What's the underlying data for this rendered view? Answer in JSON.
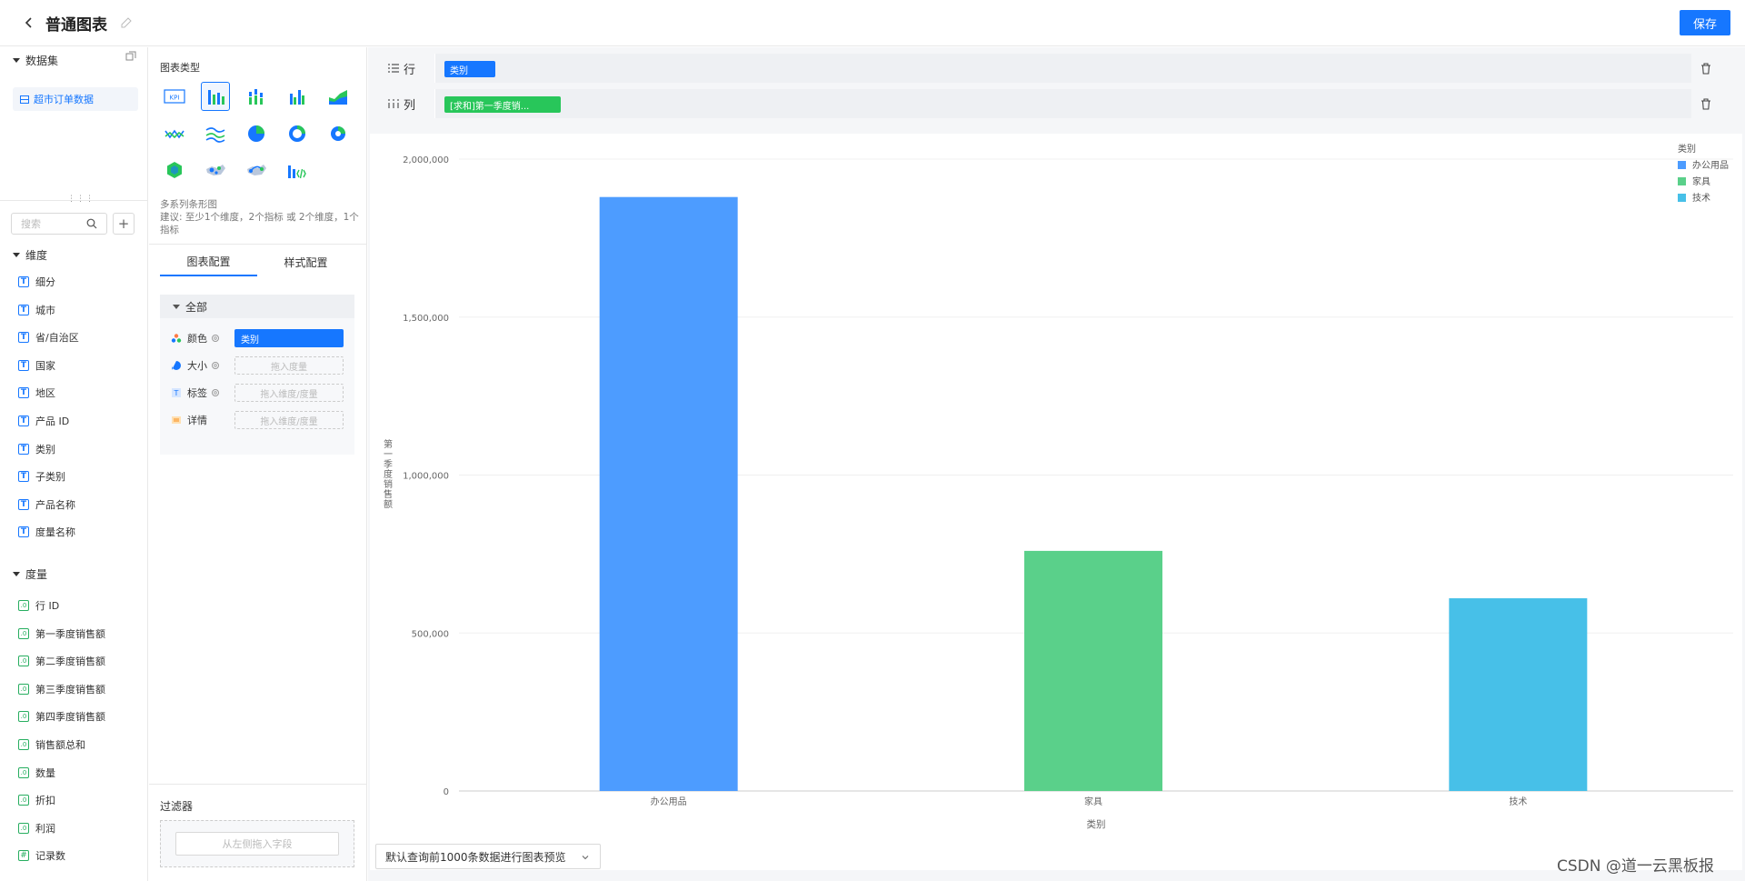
{
  "header": {
    "title": "普通图表",
    "save_label": "保存"
  },
  "left": {
    "dataset_section": "数据集",
    "dataset_name": "超市订单数据",
    "search_placeholder": "搜索",
    "dimension_section": "维度",
    "dimensions": [
      "细分",
      "城市",
      "省/自治区",
      "国家",
      "地区",
      "产品 ID",
      "类别",
      "子类别",
      "产品名称",
      "度量名称"
    ],
    "measure_section": "度量",
    "measures": [
      "行 ID",
      "第一季度销售额",
      "第二季度销售额",
      "第三季度销售额",
      "第四季度销售额",
      "销售额总和",
      "数量",
      "折扣",
      "利润",
      "记录数"
    ]
  },
  "middle": {
    "chart_type_label": "图表类型",
    "chart_types": [
      "kpi",
      "multi-bar",
      "stacked-bar",
      "grouped-bar",
      "area",
      "line",
      "multi-line",
      "pie",
      "donut",
      "ring",
      "hex-map",
      "scatter-map",
      "flow-map",
      "custom-bar"
    ],
    "hint_title": "多系列条形图",
    "hint_text": "建议: 至少1个维度，2个指标 或 2个维度，1个指标",
    "tab_chart": "图表配置",
    "tab_style": "样式配置",
    "group_all": "全部",
    "color_label": "颜色",
    "color_value": "类别",
    "size_label": "大小",
    "size_placeholder": "拖入度量",
    "label_label": "标签",
    "label_placeholder": "拖入维度/度量",
    "detail_label": "详情",
    "detail_placeholder": "拖入维度/度量",
    "filter_label": "过滤器",
    "filter_placeholder": "从左侧拖入字段"
  },
  "shelves": {
    "row_label": "行",
    "row_pill": "类别",
    "col_label": "列",
    "col_pill": "[求和]第一季度销..."
  },
  "preview_label": "默认查询前1000条数据进行图表预览",
  "watermark": "CSDN @道一云黑板报",
  "colors": {
    "accent": "#1677ff",
    "office": "#4d9cff",
    "furniture": "#5ad08a",
    "tech": "#47c0e8",
    "col_pill": "#28c65a"
  },
  "chart_data": {
    "type": "bar",
    "categories": [
      "办公用品",
      "家具",
      "技术"
    ],
    "values": [
      1880000,
      760000,
      610000
    ],
    "xlabel": "类别",
    "ylabel": "第一季度销售额",
    "ylim": [
      0,
      2000000
    ],
    "yticks": [
      "0",
      "500,000",
      "1,000,000",
      "1,500,000",
      "2,000,000"
    ],
    "legend_title": "类别",
    "legend": [
      "办公用品",
      "家具",
      "技术"
    ],
    "legend_position": "top-right",
    "grid": true
  }
}
